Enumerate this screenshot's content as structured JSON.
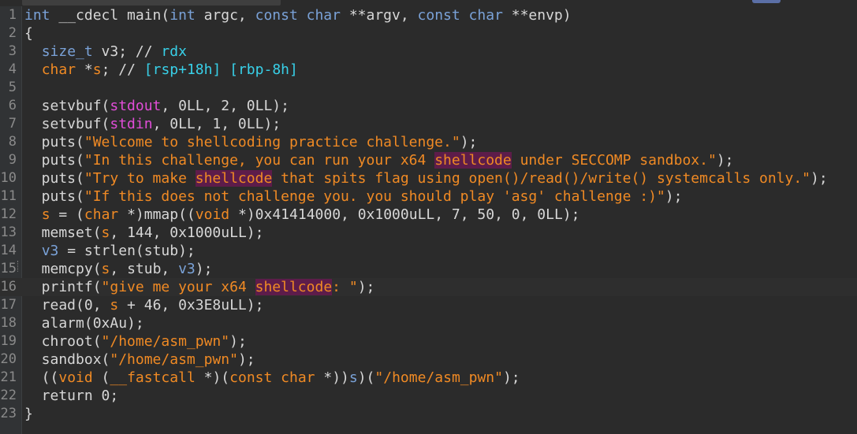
{
  "editor": {
    "lines": [
      {
        "n": "1",
        "segs": [
          [
            "kw",
            "int"
          ],
          [
            "fn",
            " __cdecl main("
          ],
          [
            "kw",
            "int"
          ],
          [
            "fn",
            " argc, "
          ],
          [
            "kw",
            "const char"
          ],
          [
            "fn",
            " **argv, "
          ],
          [
            "kw",
            "const char"
          ],
          [
            "fn",
            " **envp)"
          ]
        ]
      },
      {
        "n": "2",
        "segs": [
          [
            "fn",
            "{"
          ]
        ]
      },
      {
        "n": "3",
        "segs": [
          [
            "fn",
            "  "
          ],
          [
            "kw",
            "size_t"
          ],
          [
            "fn",
            " v3; // "
          ],
          [
            "reg",
            "rdx"
          ]
        ]
      },
      {
        "n": "4",
        "segs": [
          [
            "fn",
            "  "
          ],
          [
            "str",
            "char"
          ],
          [
            "fn",
            " *"
          ],
          [
            "str",
            "s"
          ],
          [
            "fn",
            "; // "
          ],
          [
            "reg",
            "[rsp+18h] [rbp-8h]"
          ]
        ]
      },
      {
        "n": "5",
        "segs": [
          [
            "fn",
            ""
          ]
        ]
      },
      {
        "n": "6",
        "segs": [
          [
            "fn",
            "  setvbuf("
          ],
          [
            "glob",
            "stdout"
          ],
          [
            "fn",
            ", 0LL, 2, 0LL);"
          ]
        ]
      },
      {
        "n": "7",
        "segs": [
          [
            "fn",
            "  setvbuf("
          ],
          [
            "glob",
            "stdin"
          ],
          [
            "fn",
            ", 0LL, 1, 0LL);"
          ]
        ]
      },
      {
        "n": "8",
        "segs": [
          [
            "fn",
            "  puts("
          ],
          [
            "str",
            "\"Welcome to shellcoding practice challenge.\""
          ],
          [
            "fn",
            ");"
          ]
        ]
      },
      {
        "n": "9",
        "segs": [
          [
            "fn",
            "  puts("
          ],
          [
            "str",
            "\"In this challenge, you can run your x64 "
          ],
          [
            "hl",
            "shellcode"
          ],
          [
            "str",
            " under SECCOMP sandbox.\""
          ],
          [
            "fn",
            ");"
          ]
        ]
      },
      {
        "n": "10",
        "segs": [
          [
            "fn",
            "  puts("
          ],
          [
            "str",
            "\"Try to make "
          ],
          [
            "hl",
            "shellcode"
          ],
          [
            "str",
            " that spits flag using open()/read()/write() systemcalls only.\""
          ],
          [
            "fn",
            ");"
          ]
        ]
      },
      {
        "n": "11",
        "segs": [
          [
            "fn",
            "  puts("
          ],
          [
            "str",
            "\"If this does not challenge you. you should play 'asg' challenge :)\""
          ],
          [
            "fn",
            ");"
          ]
        ]
      },
      {
        "n": "12",
        "segs": [
          [
            "fn",
            "  "
          ],
          [
            "str",
            "s"
          ],
          [
            "fn",
            " = ("
          ],
          [
            "str",
            "char"
          ],
          [
            "fn",
            " *)mmap(("
          ],
          [
            "str",
            "void"
          ],
          [
            "fn",
            " *)0x41414000, 0x1000uLL, 7, 50, 0, 0LL);"
          ]
        ]
      },
      {
        "n": "13",
        "segs": [
          [
            "fn",
            "  memset("
          ],
          [
            "str",
            "s"
          ],
          [
            "fn",
            ", 144, 0x1000uLL);"
          ]
        ]
      },
      {
        "n": "14",
        "segs": [
          [
            "fn",
            "  "
          ],
          [
            "var",
            "v3"
          ],
          [
            "fn",
            " = strlen(stub);"
          ]
        ]
      },
      {
        "n": "15",
        "segs": [
          [
            "fn",
            "  memcpy("
          ],
          [
            "str",
            "s"
          ],
          [
            "fn",
            ", stub, "
          ],
          [
            "var",
            "v3"
          ],
          [
            "fn",
            ");"
          ]
        ]
      },
      {
        "n": "16",
        "segs": [
          [
            "fn",
            "  printf("
          ],
          [
            "str",
            "\"give me your x64 "
          ],
          [
            "hl",
            "shellcode"
          ],
          [
            "str",
            ": \""
          ],
          [
            "fn",
            ");"
          ]
        ]
      },
      {
        "n": "17",
        "segs": [
          [
            "fn",
            "  read(0, "
          ],
          [
            "str",
            "s"
          ],
          [
            "fn",
            " + 46, 0x3E8uLL);"
          ]
        ]
      },
      {
        "n": "18",
        "segs": [
          [
            "fn",
            "  alarm(0xAu);"
          ]
        ]
      },
      {
        "n": "19",
        "segs": [
          [
            "fn",
            "  chroot("
          ],
          [
            "str",
            "\"/home/asm_pwn\""
          ],
          [
            "fn",
            ");"
          ]
        ]
      },
      {
        "n": "20",
        "segs": [
          [
            "fn",
            "  sandbox("
          ],
          [
            "str",
            "\"/home/asm_pwn\""
          ],
          [
            "fn",
            ");"
          ]
        ]
      },
      {
        "n": "21",
        "segs": [
          [
            "fn",
            "  (("
          ],
          [
            "str",
            "void"
          ],
          [
            "fn",
            " ("
          ],
          [
            "str",
            "__fastcall"
          ],
          [
            "fn",
            " *)("
          ],
          [
            "str",
            "const char"
          ],
          [
            "fn",
            " *))"
          ],
          [
            "var",
            "s"
          ],
          [
            "fn",
            ")("
          ],
          [
            "str",
            "\"/home/asm_pwn\""
          ],
          [
            "fn",
            ");"
          ]
        ]
      },
      {
        "n": "22",
        "segs": [
          [
            "fn",
            "  return 0;"
          ]
        ]
      },
      {
        "n": "23",
        "segs": [
          [
            "fn",
            "}"
          ]
        ]
      }
    ]
  },
  "colors": {
    "background": "#2b2b2b",
    "keyword": "#7aa2d8",
    "string": "#f08a24",
    "register_comment": "#38d0e8",
    "global": "#e14dd8",
    "highlight_bg": "#5d1c4a"
  }
}
